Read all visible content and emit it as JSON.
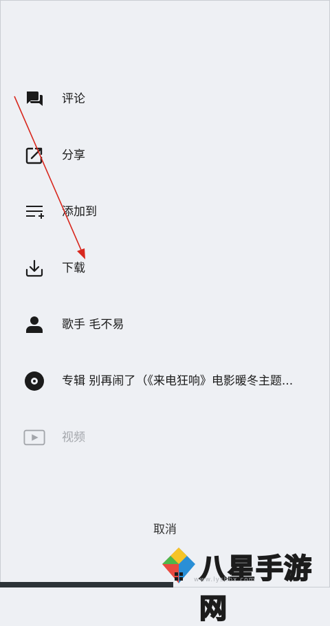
{
  "menu": {
    "items": [
      {
        "label": "评论",
        "icon": "comment-icon"
      },
      {
        "label": "分享",
        "icon": "share-icon"
      },
      {
        "label": "添加到",
        "icon": "add-to-playlist-icon"
      },
      {
        "label": "下载",
        "icon": "download-icon"
      },
      {
        "label": "歌手 毛不易",
        "icon": "person-icon"
      },
      {
        "label": "专辑 别再闹了（《来电狂响》电影暖冬主题...",
        "icon": "album-disc-icon"
      },
      {
        "label": "视频",
        "icon": "video-play-icon"
      }
    ]
  },
  "cancel_label": "取消",
  "watermark": {
    "brand": "八星手游网",
    "url": "www.lyshbx.com"
  },
  "colors": {
    "background": "#eef0f4",
    "annotation_arrow": "#d8281e",
    "disabled_text": "#a3a6ab"
  }
}
